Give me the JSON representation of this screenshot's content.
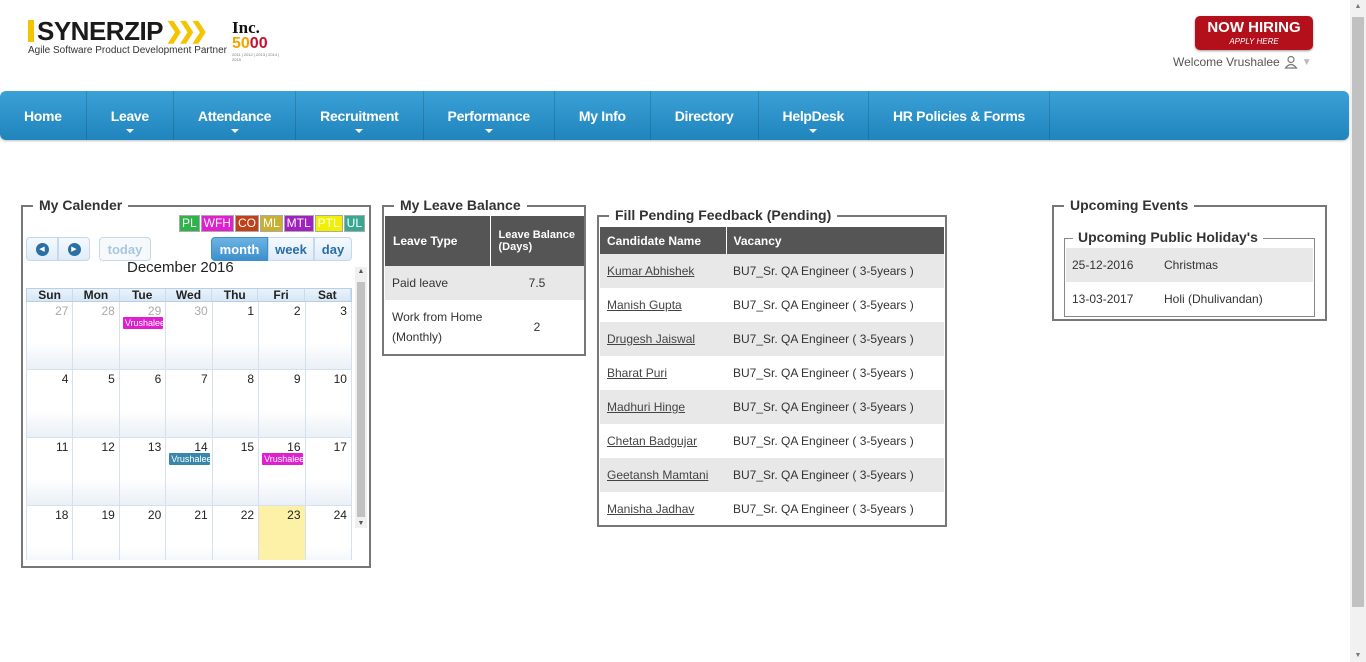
{
  "header": {
    "logo_text": "SYNERZIP",
    "logo_tagline": "Agile Software Product Development Partner",
    "inc_word": "Inc.",
    "inc_num_a": "50",
    "inc_num_b": "00",
    "inc_years": "2011 | 2012 | 2013 | 2014 | 2015",
    "hiring_main": "NOW HIRING",
    "hiring_sub": "APPLY HERE",
    "welcome": "Welcome Vrushalee"
  },
  "nav": [
    {
      "label": "Home",
      "dropdown": false
    },
    {
      "label": "Leave",
      "dropdown": true
    },
    {
      "label": "Attendance",
      "dropdown": true
    },
    {
      "label": "Recruitment",
      "dropdown": true
    },
    {
      "label": "Performance",
      "dropdown": true
    },
    {
      "label": "My Info",
      "dropdown": false
    },
    {
      "label": "Directory",
      "dropdown": false
    },
    {
      "label": "HelpDesk",
      "dropdown": true
    },
    {
      "label": "HR Policies & Forms",
      "dropdown": false
    }
  ],
  "calendar": {
    "panel_title": "My Calender",
    "legend": [
      {
        "label": "PL",
        "color": "#2db34a"
      },
      {
        "label": "WFH",
        "color": "#e020d0"
      },
      {
        "label": "CO",
        "color": "#c0401a"
      },
      {
        "label": "ML",
        "color": "#c8b030"
      },
      {
        "label": "MTL",
        "color": "#a020c0"
      },
      {
        "label": "PTL",
        "color": "#f0f000"
      },
      {
        "label": "UL",
        "color": "#3aa890"
      }
    ],
    "today_label": "today",
    "month_label": "month",
    "week_label": "week",
    "day_label": "day",
    "title": "December 2016",
    "weekdays": [
      "Sun",
      "Mon",
      "Tue",
      "Wed",
      "Thu",
      "Fri",
      "Sat"
    ],
    "weeks": [
      [
        {
          "d": "27",
          "other": true
        },
        {
          "d": "28",
          "other": true
        },
        {
          "d": "29",
          "other": true,
          "event": "Vrushalee",
          "color": "#e020d0"
        },
        {
          "d": "30",
          "other": true
        },
        {
          "d": "1"
        },
        {
          "d": "2"
        },
        {
          "d": "3"
        }
      ],
      [
        {
          "d": "4"
        },
        {
          "d": "5"
        },
        {
          "d": "6"
        },
        {
          "d": "7"
        },
        {
          "d": "8"
        },
        {
          "d": "9"
        },
        {
          "d": "10"
        }
      ],
      [
        {
          "d": "11"
        },
        {
          "d": "12"
        },
        {
          "d": "13"
        },
        {
          "d": "14",
          "event": "Vrushalee",
          "color": "#3a87ad"
        },
        {
          "d": "15"
        },
        {
          "d": "16",
          "event": "Vrushalee",
          "color": "#e020d0"
        },
        {
          "d": "17"
        }
      ],
      [
        {
          "d": "18"
        },
        {
          "d": "19"
        },
        {
          "d": "20"
        },
        {
          "d": "21"
        },
        {
          "d": "22"
        },
        {
          "d": "23",
          "today": true
        },
        {
          "d": "24"
        }
      ]
    ]
  },
  "leave": {
    "panel_title": "My Leave Balance",
    "col_type": "Leave Type",
    "col_balance": "Leave Balance (Days)",
    "rows": [
      {
        "type": "Paid leave",
        "balance": "7.5"
      },
      {
        "type": "Work from Home (Monthly)",
        "balance": "2"
      }
    ]
  },
  "feedback": {
    "panel_title": "Fill Pending Feedback (Pending)",
    "col_candidate": "Candidate Name",
    "col_vacancy": "Vacancy",
    "rows": [
      {
        "name": "Kumar Abhishek",
        "vacancy": "BU7_Sr. QA Engineer ( 3-5years )"
      },
      {
        "name": "Manish Gupta",
        "vacancy": "BU7_Sr. QA Engineer ( 3-5years )"
      },
      {
        "name": "Drugesh Jaiswal",
        "vacancy": "BU7_Sr. QA Engineer ( 3-5years )"
      },
      {
        "name": "Bharat Puri",
        "vacancy": "BU7_Sr. QA Engineer ( 3-5years )"
      },
      {
        "name": "Madhuri Hinge",
        "vacancy": "BU7_Sr. QA Engineer ( 3-5years )"
      },
      {
        "name": "Chetan Badgujar",
        "vacancy": "BU7_Sr. QA Engineer ( 3-5years )"
      },
      {
        "name": "Geetansh Mamtani",
        "vacancy": "BU7_Sr. QA Engineer ( 3-5years )"
      },
      {
        "name": "Manisha Jadhav",
        "vacancy": "BU7_Sr. QA Engineer ( 3-5years )"
      }
    ]
  },
  "events": {
    "panel_title": "Upcoming Events",
    "sub_title": "Upcoming Public Holiday's",
    "rows": [
      {
        "date": "25-12-2016",
        "name": "Christmas"
      },
      {
        "date": "13-03-2017",
        "name": "Holi (Dhulivandan)"
      }
    ]
  }
}
